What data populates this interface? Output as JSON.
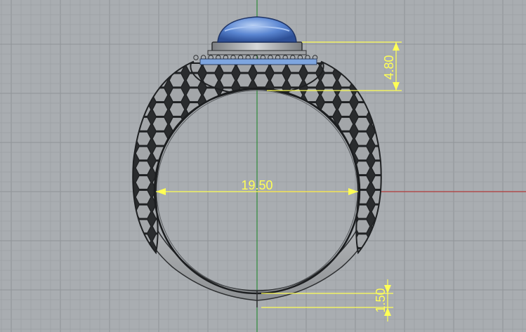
{
  "viewport": {
    "background": "#a9adb1",
    "grid_minor_color": "#9da1a5",
    "grid_major_color": "#8f9397",
    "axis_x_color": "#b23a3a",
    "axis_y_color": "#2f8a3a"
  },
  "dimensions": {
    "color": "#ffff55",
    "ring_inner_diameter": "19.50",
    "stone_height": "4.80",
    "shank_thickness": "1.50"
  },
  "model": {
    "metal_color": "#b9bbbd",
    "metal_shadow": "#6f7275",
    "stone_color": "#4a78c8",
    "stone_highlight": "#a8c4f2",
    "pave_color": "#8fb4ea"
  }
}
